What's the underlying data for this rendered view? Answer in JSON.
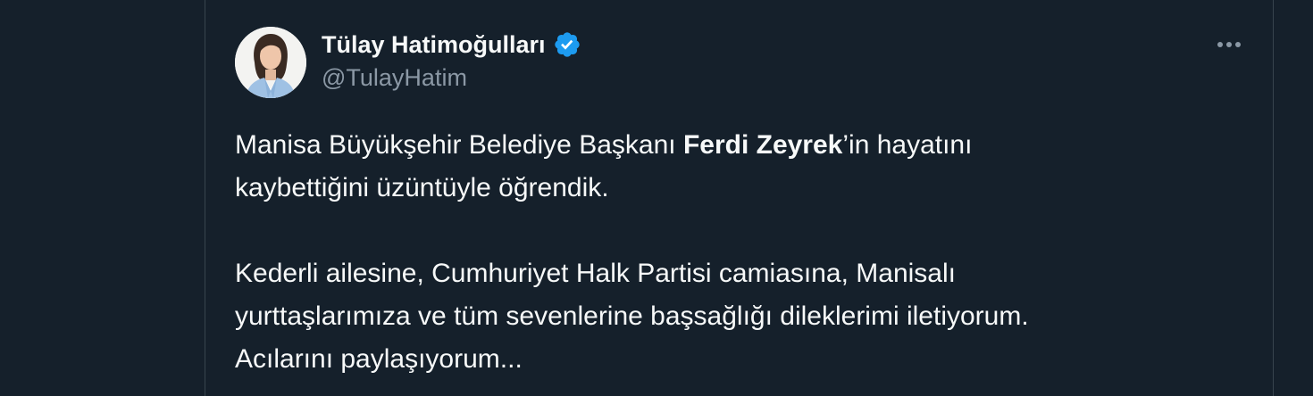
{
  "author": {
    "display_name": "Tülay Hatimoğulları",
    "handle": "@TulayHatim",
    "verified_color": "#1d9bf0",
    "avatar_icon": "profile-photo"
  },
  "menu": {
    "icon": "more-options-icon"
  },
  "tweet": {
    "line1_part1": "Manisa Büyükşehir Belediye Başkanı ",
    "line1_bold": "Ferdi Zeyrek",
    "line1_part2": "’in hayatını",
    "line2": "kaybettiğini üzüntüyle öğrendik.",
    "line3": "Kederli ailesine, Cumhuriyet Halk Partisi camiasına, Manisalı",
    "line4": "yurttaşlarımıza ve tüm sevenlerine başsağlığı dileklerimi iletiyorum.",
    "line5": "Acılarını paylaşıyorum..."
  },
  "colors": {
    "background": "#15202b",
    "border": "#38444d",
    "text": "#f7f9f9",
    "secondary_text": "#8b98a5"
  }
}
